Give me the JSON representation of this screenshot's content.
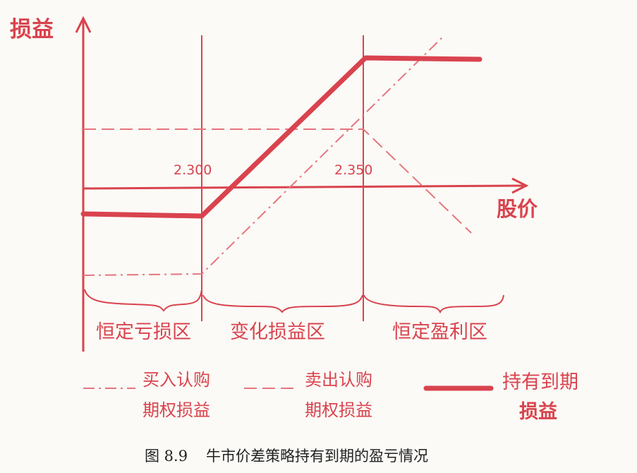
{
  "axes": {
    "y_label": "损益",
    "x_label": "股价"
  },
  "strikes": {
    "low": "2.300",
    "high": "2.350"
  },
  "zones": {
    "left": "恒定亏损区",
    "middle": "变化损益区",
    "right": "恒定盈利区"
  },
  "legend": {
    "buy_call_line1": "买入认购",
    "buy_call_line2": "期权损益",
    "sell_call_line1": "卖出认购",
    "sell_call_line2": "期权损益",
    "hold_line1": "持有到期",
    "hold_line2": "损益"
  },
  "caption": {
    "number": "图 8.9",
    "text": "牛市价差策略持有到期的盈亏情况"
  },
  "colors": {
    "ink": "#d9434e",
    "caption": "#222222"
  }
}
